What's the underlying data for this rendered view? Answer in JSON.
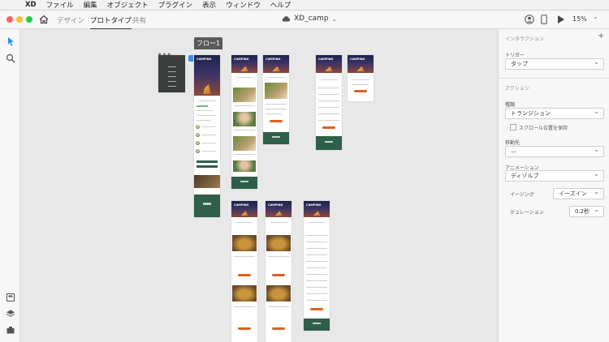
{
  "menubar": {
    "apple": "",
    "items": [
      "XD",
      "ファイル",
      "編集",
      "オブジェクト",
      "プラグイン",
      "表示",
      "ウィンドウ",
      "ヘルプ"
    ]
  },
  "toolbar": {
    "tabs": [
      "デザイン",
      "プロトタイプ",
      "共有"
    ],
    "active_tab": "プロトタイプ",
    "doc_title": "XD_camp",
    "zoom": "15%"
  },
  "canvas": {
    "flow_label": "フロー1",
    "artboard_logo": "CAMPING"
  },
  "panel": {
    "interaction_title": "インタラクション",
    "trigger_label": "トリガー",
    "trigger_value": "タップ",
    "action_title": "アクション",
    "type_label": "種類",
    "type_value": "トランジション",
    "preserve_scroll_label": "スクロール位置を保持",
    "destination_label": "移動先",
    "destination_value": "—",
    "animation_label": "アニメーション",
    "animation_value": "ディゾルブ",
    "easing_label": "イージング",
    "easing_value": "イーズイン",
    "duration_label": "デュレーション",
    "duration_value": "0.2秒"
  },
  "colors": {
    "accent_orange": "#d9641e",
    "footer_green": "#2f5e4a",
    "flow_blue": "#3d8ee8"
  }
}
